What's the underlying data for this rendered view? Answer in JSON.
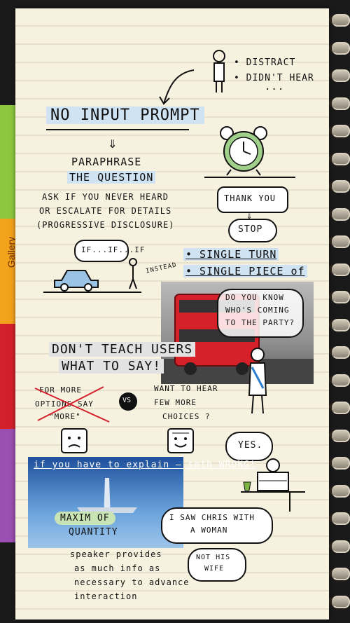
{
  "sidebar": {
    "gallery_label": "Gallery",
    "tab_colors": [
      "#8dc63f",
      "#f3a21b",
      "#d3212c",
      "#9b4fb0"
    ]
  },
  "notes": {
    "distract": "• DISTRACT",
    "didnt_hear": "• DIDN'T HEAR",
    "dots": "...",
    "no_input_prompt": "NO INPUT PROMPT",
    "arrow_down": "⇓",
    "paraphrase_1": "PARAPHRASE",
    "paraphrase_2": "THE QUESTION",
    "ask_1": "ASK IF YOU NEVER HEARD",
    "ask_2": "OR ESCALATE FOR DETAILS",
    "ask_3": "(PROGRESSIVE DISCLOSURE)",
    "thank_you": "THANK YOU",
    "stop": "STOP",
    "if_if_if": "IF...IF...IF",
    "instead": "INSTEAD",
    "single_turn": "• SINGLE TURN",
    "single_piece": "• SINGLE PIECE of",
    "do_you_know_1": "DO YOU KNOW",
    "do_you_know_2": "WHO'S COMING",
    "do_you_know_3": "TO THE PARTY?",
    "dont_teach_1": "DON'T TEACH USERS",
    "dont_teach_2": "WHAT TO SAY!",
    "for_more_1": "FOR MORE",
    "for_more_2": "OPTIONS SAY",
    "for_more_3": "\"MORE\"",
    "vs": "VS",
    "want_1": "WANT TO HEAR",
    "want_2": "FEW MORE",
    "want_3": "CHOICES ?",
    "yes": "YES.",
    "explain": "if you have to explain – smth WRONG!",
    "maxim_1": "MAXIM of",
    "maxim_2": "QUANTITY",
    "chris_1": "I SAW CHRIS WITH",
    "chris_2": "A WOMAN",
    "not_his_1": "NOT HIS",
    "not_his_2": "WIFE",
    "speaker_1": "speaker provides",
    "speaker_2": "as much info as",
    "speaker_3": "necessary to advance",
    "speaker_4": "interaction"
  }
}
